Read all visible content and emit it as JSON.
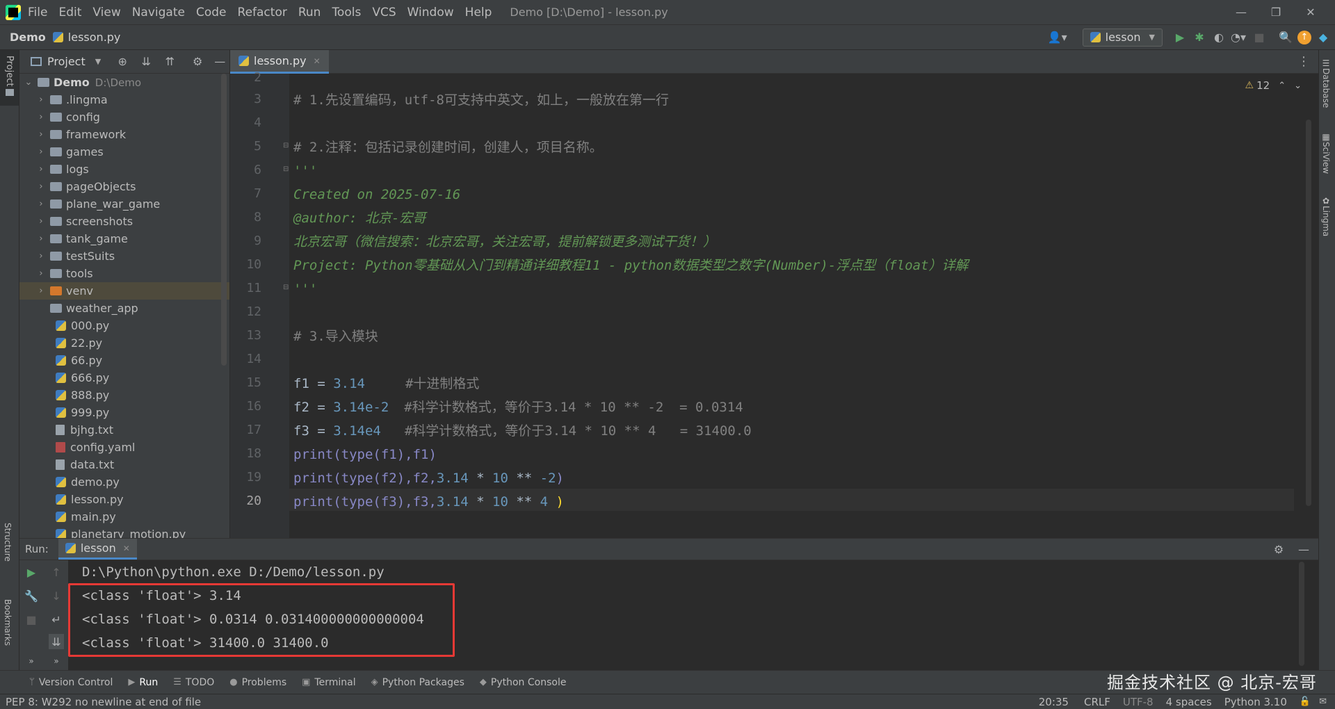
{
  "window": {
    "title": "Demo [D:\\Demo] - lesson.py",
    "menu": [
      "File",
      "Edit",
      "View",
      "Navigate",
      "Code",
      "Refactor",
      "Run",
      "Tools",
      "VCS",
      "Window",
      "Help"
    ]
  },
  "navbar": {
    "breadcrumb_project": "Demo",
    "breadcrumb_file": "lesson.py",
    "run_config": "lesson"
  },
  "sidebar_left": {
    "project_tab": "Project",
    "structure_tab": "Structure",
    "bookmarks_tab": "Bookmarks"
  },
  "sidebar_right": {
    "database_tab": "Database",
    "sciview_tab": "SciView",
    "lingma_tab": "Lingma"
  },
  "project_panel": {
    "title": "Project",
    "root_name": "Demo",
    "root_path": "D:\\Demo",
    "folders": [
      ".lingma",
      "config",
      "framework",
      "games",
      "logs",
      "pageObjects",
      "plane_war_game",
      "screenshots",
      "tank_game",
      "testSuits",
      "tools",
      "venv",
      "weather_app"
    ],
    "files": [
      "000.py",
      "22.py",
      "66.py",
      "666.py",
      "888.py",
      "999.py",
      "bjhg.txt",
      "config.yaml",
      "data.txt",
      "demo.py",
      "lesson.py",
      "main.py",
      "planetary_motion.py"
    ]
  },
  "editor": {
    "tab_label": "lesson.py",
    "warnings_count": "12",
    "line_numbers": [
      "2",
      "3",
      "4",
      "5",
      "6",
      "7",
      "8",
      "9",
      "10",
      "11",
      "12",
      "13",
      "14",
      "15",
      "16",
      "17",
      "18",
      "19",
      "20"
    ],
    "lines": {
      "l3": "# 1.先设置编码，utf-8可支持中英文，如上，一般放在第一行",
      "l5": "# 2.注释：包括记录创建时间，创建人，项目名称。",
      "l6": "'''",
      "l7": "Created on 2025-07-16",
      "l8": "@author: 北京-宏哥",
      "l9": "北京宏哥（微信搜索：北京宏哥，关注宏哥，提前解锁更多测试干货！）",
      "l10": "Project: Python零基础从入门到精通详细教程11 - python数据类型之数字(Number)-浮点型（float）详解",
      "l11": "'''",
      "l13": "# 3.导入模块",
      "l15_code": "f1 = ",
      "l15_num": "3.14",
      "l15_comment": "#十进制格式",
      "l16_code": "f2 = ",
      "l16_num": "3.14e-2",
      "l16_comment": "#科学计数格式，等价于3.14 * 10 ** -2  = 0.0314",
      "l17_code": "f3 = ",
      "l17_num": "3.14e4",
      "l17_comment": "#科学计数格式，等价于3.14 * 10 ** 4   = 31400.0",
      "l18": "print(type(f1),f1)",
      "l19_a": "print(type(f2),f2,",
      "l19_b": "3.14",
      "l19_c": " * ",
      "l19_d": "10",
      "l19_e": " ** ",
      "l19_f": "-2",
      "l19_g": ")",
      "l20_a": "print(type(f3),f3,",
      "l20_b": "3.14",
      "l20_c": " * ",
      "l20_d": "10",
      "l20_e": " ** ",
      "l20_f": "4",
      "l20_g": " )"
    }
  },
  "run_panel": {
    "label": "Run:",
    "tab": "lesson",
    "command": "D:\\Python\\python.exe D:/Demo/lesson.py",
    "output": [
      "<class 'float'> 3.14",
      "<class 'float'> 0.0314 0.031400000000000004",
      "<class 'float'> 31400.0 31400.0"
    ]
  },
  "bottom_tools": [
    "Version Control",
    "Run",
    "TODO",
    "Problems",
    "Terminal",
    "Python Packages",
    "Python Console"
  ],
  "status": {
    "message": "PEP 8: W292 no newline at end of file",
    "position": "20:35",
    "line_sep": "CRLF",
    "encoding": "UTF-8",
    "indent": "4 spaces",
    "interpreter": "Python 3.10"
  },
  "watermark": "掘金技术社区 @ 北京-宏哥"
}
